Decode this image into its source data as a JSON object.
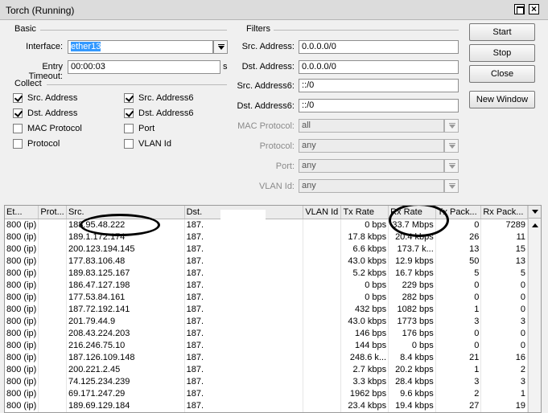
{
  "window": {
    "title": "Torch (Running)"
  },
  "basic": {
    "group_label": "Basic",
    "interface_label": "Interface:",
    "interface_value": "ether13",
    "timeout_label": "Entry Timeout:",
    "timeout_value": "00:00:03",
    "timeout_unit": "s"
  },
  "collect": {
    "group_label": "Collect",
    "items": [
      {
        "label": "Src. Address",
        "checked": true
      },
      {
        "label": "Dst. Address",
        "checked": true
      },
      {
        "label": "MAC Protocol",
        "checked": false
      },
      {
        "label": "Protocol",
        "checked": false
      },
      {
        "label": "Src. Address6",
        "checked": true
      },
      {
        "label": "Dst. Address6",
        "checked": true
      },
      {
        "label": "Port",
        "checked": false
      },
      {
        "label": "VLAN Id",
        "checked": false
      }
    ]
  },
  "filters": {
    "group_label": "Filters",
    "src_label": "Src. Address:",
    "src_value": "0.0.0.0/0",
    "dst_label": "Dst. Address:",
    "dst_value": "0.0.0.0/0",
    "src6_label": "Src. Address6:",
    "src6_value": "::/0",
    "dst6_label": "Dst. Address6:",
    "dst6_value": "::/0",
    "mac_label": "MAC Protocol:",
    "mac_value": "all",
    "proto_label": "Protocol:",
    "proto_value": "any",
    "port_label": "Port:",
    "port_value": "any",
    "vlan_label": "VLAN Id:",
    "vlan_value": "any"
  },
  "buttons": {
    "start": "Start",
    "stop": "Stop",
    "close": "Close",
    "new_window": "New Window"
  },
  "table": {
    "columns": [
      "Et...",
      "Prot...",
      "Src.",
      "Dst.",
      "VLAN Id",
      "Tx Rate",
      "Rx Rate",
      "Tx Pack...",
      "Rx Pack..."
    ],
    "rows": [
      [
        "800 (ip)",
        "",
        "188.95.48.222",
        "187.",
        "",
        "0 bps",
        "33.7 Mbps",
        "0",
        "7289"
      ],
      [
        "800 (ip)",
        "",
        "189.1.172.174",
        "187.",
        "",
        "17.8 kbps",
        "20.4 kbps",
        "26",
        "11"
      ],
      [
        "800 (ip)",
        "",
        "200.123.194.145",
        "187.",
        "",
        "6.6 kbps",
        "173.7 k...",
        "13",
        "15"
      ],
      [
        "800 (ip)",
        "",
        "177.83.106.48",
        "187.",
        "",
        "43.0 kbps",
        "12.9 kbps",
        "50",
        "13"
      ],
      [
        "800 (ip)",
        "",
        "189.83.125.167",
        "187.",
        "",
        "5.2 kbps",
        "16.7 kbps",
        "5",
        "5"
      ],
      [
        "800 (ip)",
        "",
        "186.47.127.198",
        "187.",
        "",
        "0 bps",
        "229 bps",
        "0",
        "0"
      ],
      [
        "800 (ip)",
        "",
        "177.53.84.161",
        "187.",
        "",
        "0 bps",
        "282 bps",
        "0",
        "0"
      ],
      [
        "800 (ip)",
        "",
        "187.72.192.141",
        "187.",
        "",
        "432 bps",
        "1082 bps",
        "1",
        "0"
      ],
      [
        "800 (ip)",
        "",
        "201.79.44.9",
        "187.",
        "",
        "43.0 kbps",
        "1773 bps",
        "3",
        "3"
      ],
      [
        "800 (ip)",
        "",
        "208.43.224.203",
        "187.",
        "",
        "146 bps",
        "176 bps",
        "0",
        "0"
      ],
      [
        "800 (ip)",
        "",
        "216.246.75.10",
        "187.",
        "",
        "144 bps",
        "0 bps",
        "0",
        "0"
      ],
      [
        "800 (ip)",
        "",
        "187.126.109.148",
        "187.",
        "",
        "248.6 k...",
        "8.4 kbps",
        "21",
        "16"
      ],
      [
        "800 (ip)",
        "",
        "200.221.2.45",
        "187.",
        "",
        "2.7 kbps",
        "20.2 kbps",
        "1",
        "2"
      ],
      [
        "800 (ip)",
        "",
        "74.125.234.239",
        "187.",
        "",
        "3.3 kbps",
        "28.4 kbps",
        "3",
        "3"
      ],
      [
        "800 (ip)",
        "",
        "69.171.247.29",
        "187.",
        "",
        "1962 bps",
        "9.6 kbps",
        "2",
        "1"
      ],
      [
        "800 (ip)",
        "",
        "189.69.129.184",
        "187.",
        "",
        "23.4 kbps",
        "19.4 kbps",
        "27",
        "19"
      ]
    ]
  }
}
